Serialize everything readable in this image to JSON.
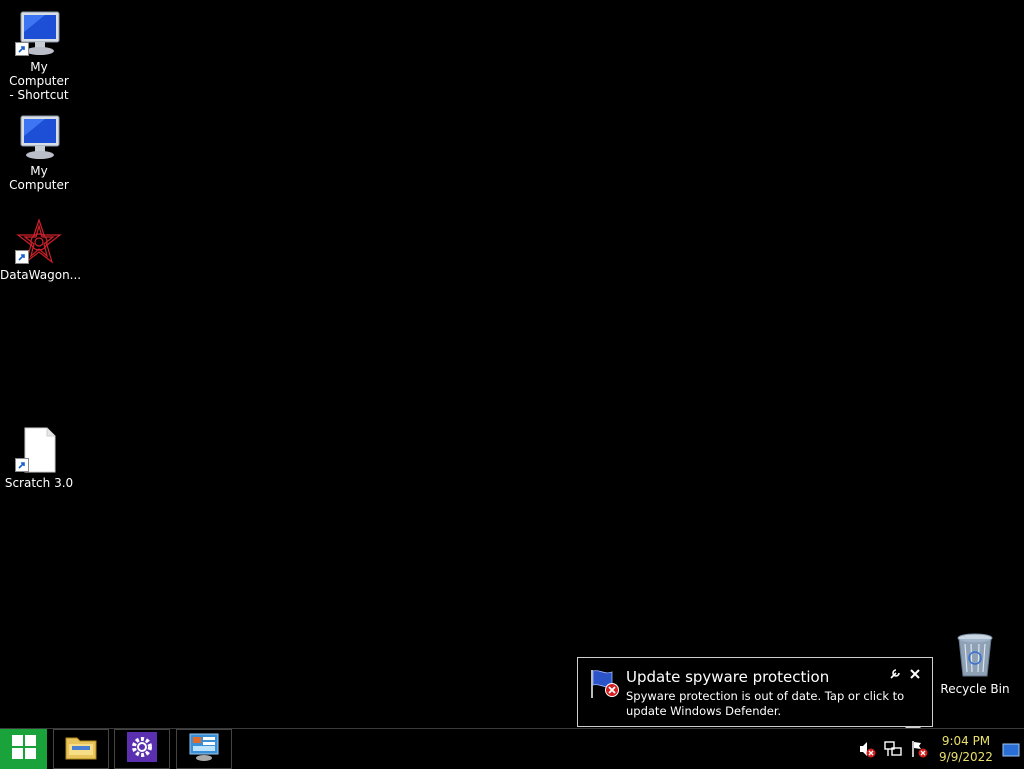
{
  "desktop": {
    "icons": [
      {
        "label": "My Computer\n- Shortcut",
        "line1": "My Computer",
        "line2": "- Shortcut"
      },
      {
        "label": "My Computer"
      },
      {
        "label": "DataWagon..."
      },
      {
        "label": "Scratch 3.0"
      },
      {
        "label": "Recycle Bin"
      }
    ]
  },
  "notification": {
    "title": "Update spyware protection",
    "body": "Spyware protection is out of date. Tap or click to update Windows Defender."
  },
  "tray": {
    "time": "9:04 PM",
    "date": "9/9/2022"
  },
  "colors": {
    "start": "#1aa33a",
    "clock_text": "#e8e06a",
    "desktop_bg": "#000000"
  }
}
